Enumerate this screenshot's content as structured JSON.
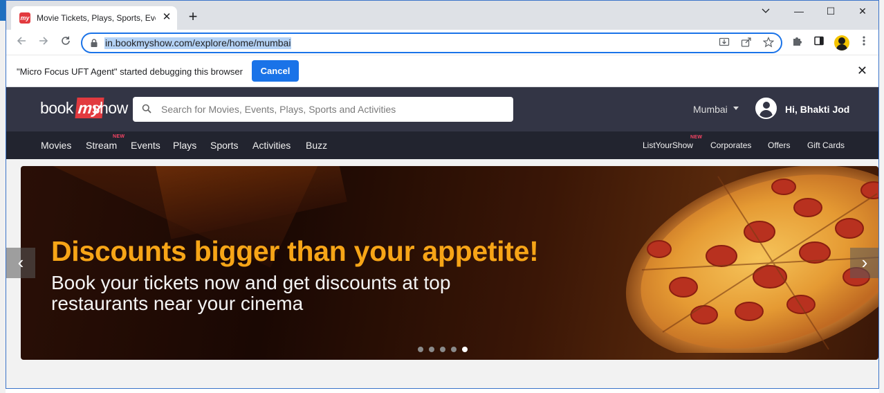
{
  "browser": {
    "tab_title": "Movie Tickets, Plays, Sports, Events & Cinemas",
    "favicon_text": "my",
    "new_tab_symbol": "+",
    "url": "in.bookmyshow.com/explore/home/mumbai",
    "window_controls": {
      "minimize": "—",
      "maximize": "☐",
      "close": "✕"
    }
  },
  "infobar": {
    "message": "\"Micro Focus UFT Agent\" started debugging this browser",
    "cancel_label": "Cancel"
  },
  "site": {
    "logo": {
      "part1": "book",
      "part2": "my",
      "part3": "show"
    },
    "search_placeholder": "Search for Movies, Events, Plays, Sports and Activities",
    "city": "Mumbai",
    "greeting": "Hi, Bhakti Jod"
  },
  "nav": {
    "left": [
      "Movies",
      "Stream",
      "Events",
      "Plays",
      "Sports",
      "Activities",
      "Buzz"
    ],
    "right": [
      "ListYourShow",
      "Corporates",
      "Offers",
      "Gift Cards"
    ],
    "new_badge": "NEW"
  },
  "banner": {
    "headline": "Discounts bigger than your appetite!",
    "sub_line1": "Book your tickets now and get discounts at top",
    "sub_line2": "restaurants near your cinema",
    "slide_count": 5,
    "active_slide": 5,
    "prev_symbol": "‹",
    "next_symbol": "›"
  },
  "colors": {
    "accent": "#1a73e8",
    "brand_red": "#e23a3f",
    "header_dark": "#333545",
    "nav_dark": "#22242f",
    "headline_orange": "#f7a517"
  }
}
